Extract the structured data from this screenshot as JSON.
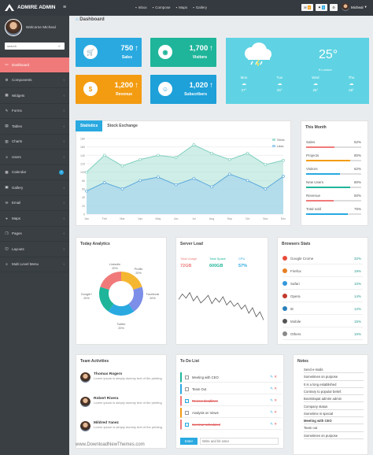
{
  "topbar": {
    "brand": "ADMIRE ADMIN",
    "nav": [
      {
        "icon": "inbox-icon",
        "label": "Inbox"
      },
      {
        "icon": "pencil-icon",
        "label": "Compose"
      },
      {
        "icon": "map-marker-icon",
        "label": "Maps"
      },
      {
        "icon": "image-icon",
        "label": "Gallery"
      }
    ],
    "badges": [
      "5",
      "3"
    ],
    "user": "Micheal"
  },
  "sidebar": {
    "welcome": "Welcome Micheal",
    "search_placeholder": "search",
    "items": [
      {
        "label": "Dashboard",
        "icon": "dashboard-icon",
        "glyph": "▭"
      },
      {
        "label": "Components",
        "icon": "gear-icon",
        "glyph": "⚙"
      },
      {
        "label": "Widgets",
        "icon": "widgets-icon",
        "glyph": "▦"
      },
      {
        "label": "Forms",
        "icon": "form-icon",
        "glyph": "✎"
      },
      {
        "label": "Tables",
        "icon": "table-icon",
        "glyph": "▤"
      },
      {
        "label": "Charts",
        "icon": "chart-icon",
        "glyph": "▥"
      },
      {
        "label": "Users",
        "icon": "users-icon",
        "glyph": "☺"
      },
      {
        "label": "Calendar",
        "icon": "calendar-icon",
        "glyph": "▦",
        "badge": "7"
      },
      {
        "label": "Gallery",
        "icon": "gallery-icon",
        "glyph": "▣"
      },
      {
        "label": "Email",
        "icon": "email-icon",
        "glyph": "✉"
      },
      {
        "label": "Maps",
        "icon": "map-icon",
        "glyph": "⌖"
      },
      {
        "label": "Pages",
        "icon": "pages-icon",
        "glyph": "❐"
      },
      {
        "label": "Layouts",
        "icon": "layout-icon",
        "glyph": "◫"
      },
      {
        "label": "Multi Level Menu",
        "icon": "menu-icon",
        "glyph": "≡"
      }
    ]
  },
  "breadcrumb": "Dashboard",
  "stats": [
    {
      "value": "750",
      "label": "Sales",
      "color": "#29a9e0",
      "icon": "cart-icon",
      "glyph": "🛒"
    },
    {
      "value": "1,700",
      "label": "Visitors",
      "color": "#1fb59a",
      "icon": "eye-icon",
      "glyph": "◉"
    },
    {
      "value": "1,200",
      "label": "Revenue",
      "color": "#f39c12",
      "icon": "dollar-icon",
      "glyph": "$"
    },
    {
      "value": "1,020",
      "label": "Subscribers",
      "color": "#1ea0d8",
      "icon": "users-icon",
      "glyph": "☺"
    }
  ],
  "weather": {
    "temp": "25°",
    "location": "London",
    "days": [
      {
        "day": "Mon",
        "temp": "27°"
      },
      {
        "day": "Tue",
        "temp": "26°"
      },
      {
        "day": "Wed",
        "temp": "25°"
      },
      {
        "day": "Thu",
        "temp": "28°"
      }
    ]
  },
  "tabs": [
    "Statistics",
    "Stock Exchange"
  ],
  "chart_data": {
    "type": "area",
    "x": [
      "Jan",
      "Feb",
      "Mar",
      "Apr",
      "May",
      "Jun",
      "Jul",
      "Aug",
      "Sep",
      "Oct",
      "Nov",
      "Dec"
    ],
    "ylim": [
      0,
      180
    ],
    "yticks": [
      0,
      20,
      40,
      60,
      80,
      100,
      120,
      140,
      160,
      180
    ],
    "series": [
      {
        "name": "Views",
        "color": "#a8e0d4",
        "values": [
          100,
          140,
          115,
          130,
          140,
          135,
          165,
          145,
          130,
          145,
          118,
          128
        ]
      },
      {
        "name": "Likes",
        "color": "#9fd0ee",
        "values": [
          55,
          75,
          60,
          80,
          88,
          70,
          85,
          65,
          95,
          80,
          60,
          90
        ]
      }
    ]
  },
  "this_month": {
    "title": "This Month",
    "rows": [
      {
        "label": "Sales",
        "pct": "52%",
        "value": 0.52,
        "color": "#f07a7a"
      },
      {
        "label": "Projects",
        "pct": "80%",
        "value": 0.8,
        "color": "#f39c12"
      },
      {
        "label": "Visitors",
        "pct": "62%",
        "value": 0.62,
        "color": "#29a9e0"
      },
      {
        "label": "New Users",
        "pct": "80%",
        "value": 0.8,
        "color": "#1fb59a"
      },
      {
        "label": "Revenue",
        "pct": "50%",
        "value": 0.5,
        "color": "#f07a7a"
      },
      {
        "label": "Total sold",
        "pct": "75%",
        "value": 0.75,
        "color": "#29a9e0"
      }
    ]
  },
  "today": {
    "title": "Today Analytics",
    "slices": [
      {
        "name": "LinkedIn",
        "pct": "20%",
        "value": 20,
        "color": "#f5b731"
      },
      {
        "name": "Profile",
        "pct": "20%",
        "value": 20,
        "color": "#7c8ee8"
      },
      {
        "name": "Facebook",
        "pct": "20%",
        "value": 20,
        "color": "#29a9e0"
      },
      {
        "name": "Twitter",
        "pct": "20%",
        "value": 20,
        "color": "#1fb59a"
      },
      {
        "name": "Google+",
        "pct": "20%",
        "value": 20,
        "color": "#f07a7a"
      }
    ]
  },
  "server": {
    "title": "Server Load",
    "cols": [
      {
        "label": "Total Usage",
        "value": "72GB",
        "color": "#f07a7a"
      },
      {
        "label": "Total Space",
        "value": "600GB",
        "color": "#1fb59a"
      },
      {
        "label": "CPU",
        "value": "57%",
        "color": "#29a9e0"
      }
    ],
    "load": [
      20,
      12,
      18,
      10,
      22,
      15,
      25,
      20,
      14,
      26,
      18,
      24,
      16,
      28,
      22,
      30,
      25,
      34,
      28,
      40,
      32,
      45,
      38,
      50
    ]
  },
  "browsers": {
    "title": "Browsers Stats",
    "items": [
      {
        "name": "Google Crome",
        "pct": "32%",
        "color": "#e74c3c",
        "icon": "chrome-icon"
      },
      {
        "name": "Firefox",
        "pct": "19%",
        "color": "#e67e22",
        "icon": "firefox-icon"
      },
      {
        "name": "Safari",
        "pct": "10%",
        "color": "#3498db",
        "icon": "safari-icon"
      },
      {
        "name": "Opera",
        "pct": "14%",
        "color": "#c0392b",
        "icon": "opera-icon"
      },
      {
        "name": "IE",
        "pct": "12%",
        "color": "#2980b9",
        "icon": "ie-icon"
      },
      {
        "name": "Mobile",
        "pct": "15%",
        "color": "#555555",
        "icon": "mobile-icon"
      },
      {
        "name": "Others",
        "pct": "10%",
        "color": "#888888",
        "icon": "globe-icon"
      }
    ]
  },
  "team": {
    "title": "Team Activities",
    "members": [
      {
        "name": "Thomas Rogers",
        "text": "Lorem ipsum is simply dummy text of the printing"
      },
      {
        "name": "Robert Rivera",
        "text": "Lorem ipsum is simply dummy text of the printing"
      },
      {
        "name": "Mildred Yanez",
        "text": "Lorem Ipsum is simply dummy text of the printing"
      }
    ]
  },
  "todo": {
    "title": "To Do List",
    "items": [
      {
        "text": "Meeting with CEO",
        "checked": false,
        "color": "#1fb59a"
      },
      {
        "text": "Team Out",
        "checked": false,
        "color": "#29a9e0"
      },
      {
        "text": "Review deadlines",
        "checked": true,
        "color": "#f07a7a"
      },
      {
        "text": "Analysis on Views",
        "checked": false,
        "color": "#f39c12"
      },
      {
        "text": "Seminar scheduled",
        "checked": true,
        "color": "#f07a7a"
      }
    ],
    "button": "Enter",
    "placeholder": "Write and hit enter"
  },
  "notes": {
    "title": "Notes",
    "items": [
      "Send e-mails",
      "Sometimes on purpose",
      "It is a long established",
      "Contrary to popular belief.",
      "Bootstrapat admire admin",
      "Company status",
      "Sometime is special",
      "Meeting with CEO",
      "Team out",
      "Sometimes on purpose"
    ]
  },
  "footer": "www.DownloadNewThemes.com"
}
